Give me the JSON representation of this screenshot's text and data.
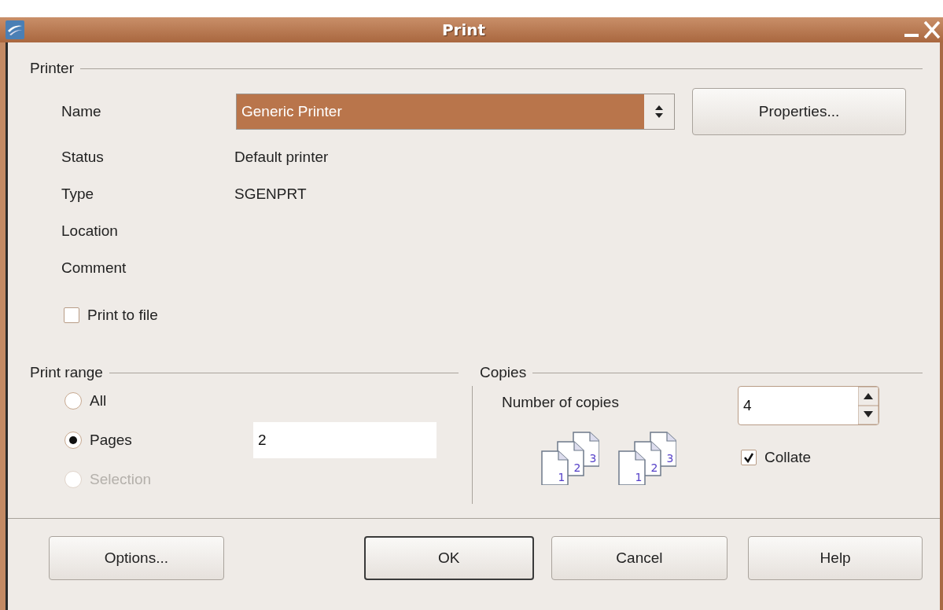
{
  "window": {
    "title": "Print"
  },
  "printer": {
    "title": "Printer",
    "name": {
      "label": "Name",
      "value": "Generic Printer"
    },
    "properties_button": {
      "label": "Properties..."
    },
    "info": [
      {
        "label": "Status",
        "value": "Default printer"
      },
      {
        "label": "Type",
        "value": "SGENPRT"
      },
      {
        "label": "Location"
      },
      {
        "label": "Comment"
      }
    ],
    "print_to_file": {
      "label": "Print to file",
      "checked": false
    }
  },
  "print_range": {
    "title": "Print range",
    "options": [
      {
        "label": "All",
        "selected": false,
        "disabled": false
      },
      {
        "label": "Pages",
        "selected": true,
        "disabled": false
      },
      {
        "label": "Selection",
        "selected": false,
        "disabled": true
      }
    ],
    "pages_value": "2"
  },
  "copies": {
    "title": "Copies",
    "number_label": "Number of copies",
    "value": "4",
    "collate_icons": [
      [
        "1",
        "2",
        "3"
      ],
      [
        "1",
        "2",
        "3"
      ]
    ],
    "collate": {
      "label": "Collate",
      "checked": true
    }
  },
  "buttons": [
    {
      "label": "Options...",
      "default": false
    },
    {
      "label": "OK",
      "default": true
    },
    {
      "label": "Cancel",
      "default": false
    },
    {
      "label": "Help",
      "default": false
    }
  ]
}
